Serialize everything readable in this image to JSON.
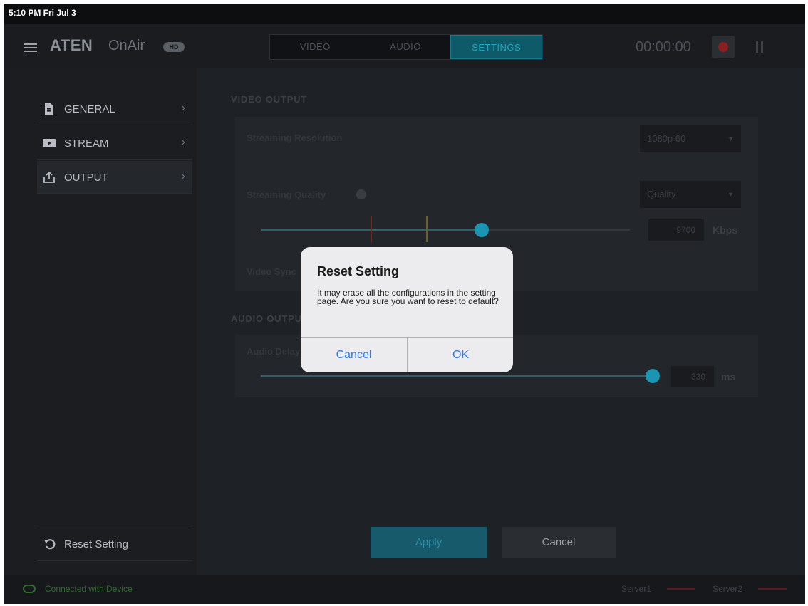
{
  "status_bar": {
    "time": "5:10 PM  Fri Jul 3"
  },
  "header": {
    "brand": "ATEN",
    "brand_sub": "OnAir",
    "brand_badge": "HD",
    "tabs": [
      {
        "label": "VIDEO",
        "active": false
      },
      {
        "label": "AUDIO",
        "active": false
      },
      {
        "label": "SETTINGS",
        "active": true
      }
    ],
    "timer": "00:00:00"
  },
  "sidebar": {
    "items": [
      {
        "label": "GENERAL",
        "icon": "document-icon"
      },
      {
        "label": "STREAM",
        "icon": "play-icon"
      },
      {
        "label": "OUTPUT",
        "icon": "share-icon"
      }
    ],
    "reset_label": "Reset Setting"
  },
  "content": {
    "video_output_title": "VIDEO OUTPUT",
    "streaming_resolution_label": "Streaming Resolution",
    "streaming_resolution_value": "1080p 60",
    "streaming_quality_label": "Streaming Quality",
    "streaming_quality_value": "Quality",
    "bitrate_value": "9700",
    "bitrate_unit": "Kbps",
    "video_sync_label": "Video Sync",
    "audio_output_title": "AUDIO OUTPUT",
    "audio_delay_label": "Audio Delay",
    "audio_delay_value": "330",
    "audio_delay_unit": "ms",
    "quality_slider_fraction": 0.6,
    "audio_slider_fraction": 1.0
  },
  "buttons": {
    "apply": "Apply",
    "cancel": "Cancel"
  },
  "footer": {
    "connection": "Connected with Device",
    "server1": "Server1",
    "server2": "Server2"
  },
  "dialog": {
    "title": "Reset Setting",
    "message": "It may erase all the configurations in the setting page. Are you sure you want to reset to default?",
    "cancel": "Cancel",
    "ok": "OK"
  },
  "colors": {
    "accent": "#1a96b2",
    "dialog_button": "#2f7bf2",
    "record": "#8a1f24"
  }
}
